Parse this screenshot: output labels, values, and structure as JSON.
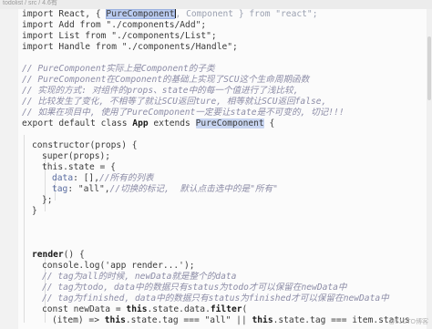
{
  "breadcrumb": "todolist / src / 4.6有",
  "watermark": "@51CTO博客",
  "lines": {
    "l1": {
      "a": "import React, { ",
      "b": "PureComponent",
      "c": ", Component } from \"react\";"
    },
    "l2": "import Add from \"./components/Add\";",
    "l3": "import List from \"./components/List\";",
    "l4": "import Handle from \"./components/Handle\";",
    "l5": "",
    "l6": "// PureComponent实际上是Component的子类",
    "l7": "// PureComponent在Component的基础上实现了SCU这个生命周期函数",
    "l8": "// 实现的方式: 对组件的props、state中的每一个值进行了浅比较,",
    "l9": "// 比较发生了变化, 不相等了就让SCU返回ture, 相等就让SCU返回false,",
    "l10": "// 如果在项目中, 使用了PureComponent一定要让state是不可变的, 切记!!!",
    "l11": {
      "a": "export default class ",
      "b": "App",
      "c": " extends ",
      "d": "PureComponent",
      "e": " {"
    },
    "l12": "",
    "l13": "constructor(props) {",
    "l14": "super(props);",
    "l15": "this.state = {",
    "l16": {
      "a": "data",
      "b": ": [],",
      "c": "//所有的列表"
    },
    "l17": {
      "a": "tag",
      "b": ": \"all\",",
      "c": "//切换的标记,  默认点击选中的是\"所有\""
    },
    "l18": "};",
    "l19": "}",
    "l20": "",
    "l21": {
      "a": "render",
      "b": "() {"
    },
    "l22": "console.log('app render...');",
    "l23": "// tag为all的时候, newData就是整个的data",
    "l24": "// tag为todo, data中的数据只有status为todo才可以保留在newData中",
    "l25": "// tag为finished, data中的数据只有status为finished才可以保留在newData中",
    "l26": {
      "a": "const newData = ",
      "b": "this",
      "c": ".state.data.",
      "d": "filter",
      "e": "("
    },
    "l27": {
      "a": "(item) => ",
      "b": "this",
      "c": ".state.tag === \"all\" || ",
      "d": "this",
      "e": ".state.tag === item.status"
    }
  }
}
